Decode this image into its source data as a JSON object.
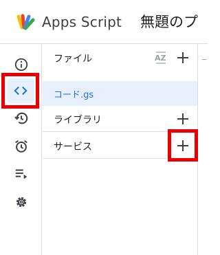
{
  "header": {
    "app_name": "Apps Script",
    "project_title": "無題のプ"
  },
  "rail": {
    "items": [
      {
        "icon": "info-icon"
      },
      {
        "icon": "code-icon",
        "active": true
      },
      {
        "icon": "history-icon"
      },
      {
        "icon": "alarm-icon"
      },
      {
        "icon": "executions-icon"
      },
      {
        "icon": "gear-icon"
      }
    ]
  },
  "files_panel": {
    "files_label": "ファイル",
    "sort_glyph": "AZ",
    "files": [
      {
        "name": "コード.gs",
        "selected": true
      }
    ],
    "libraries_label": "ライブラリ",
    "services_label": "サービス"
  },
  "colors": {
    "accent": "#1a73e8",
    "active_bg": "#e8f0fe",
    "highlight": "#ea0000",
    "divider": "#dadce0"
  }
}
